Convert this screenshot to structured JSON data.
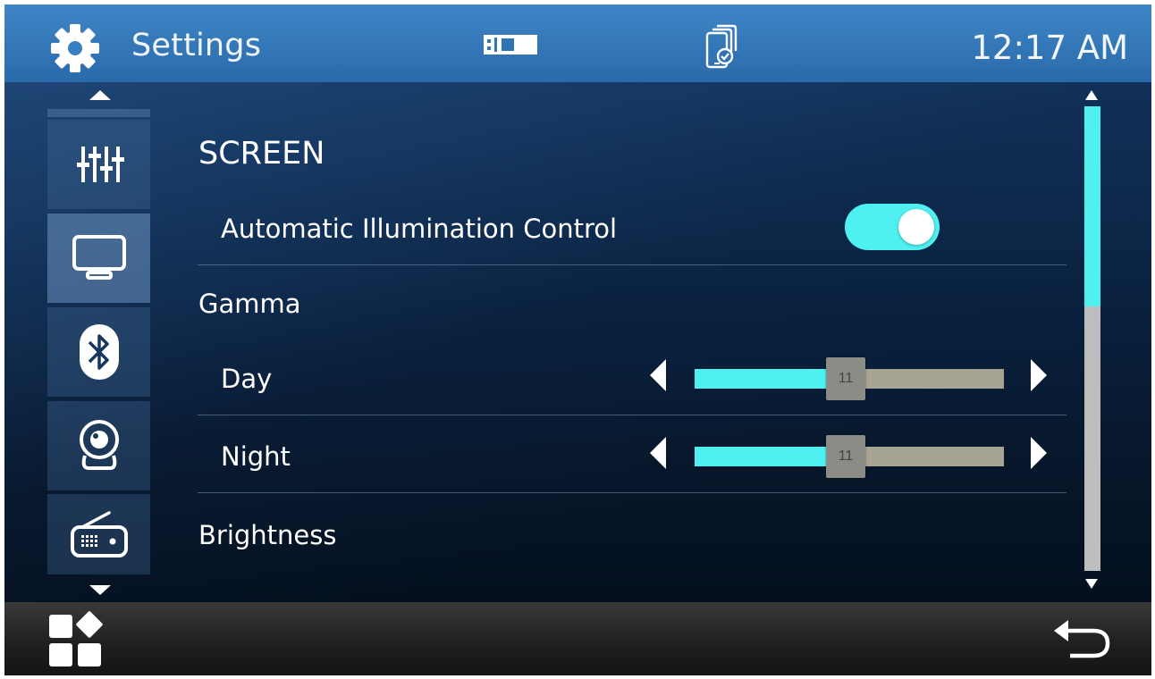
{
  "header": {
    "title": "Settings",
    "time": "12:17 AM",
    "icons": [
      "gear-icon",
      "usb-icon",
      "phone-sync-icon"
    ]
  },
  "sidebar": {
    "items": [
      {
        "icon": "equalizer-icon",
        "active": false
      },
      {
        "icon": "display-icon",
        "active": true
      },
      {
        "icon": "bluetooth-icon",
        "active": false
      },
      {
        "icon": "camera-icon",
        "active": false
      },
      {
        "icon": "radio-icon",
        "active": false
      }
    ]
  },
  "content": {
    "section_title": "SCREEN",
    "auto_illumination": {
      "label": "Automatic Illumination Control",
      "enabled": true
    },
    "gamma": {
      "label": "Gamma",
      "day": {
        "label": "Day",
        "value": "11",
        "fraction": 0.47
      },
      "night": {
        "label": "Night",
        "value": "11",
        "fraction": 0.47
      }
    },
    "brightness": {
      "label": "Brightness"
    }
  },
  "scrollbar": {
    "visible_fraction": 0.43
  },
  "footer": {
    "icons": [
      "apps-icon",
      "back-icon"
    ]
  },
  "colors": {
    "accent": "#4EF0F0",
    "header": "#3F86C6",
    "slider_track": "#A7A493",
    "scroll_track": "#BDBDBD"
  }
}
